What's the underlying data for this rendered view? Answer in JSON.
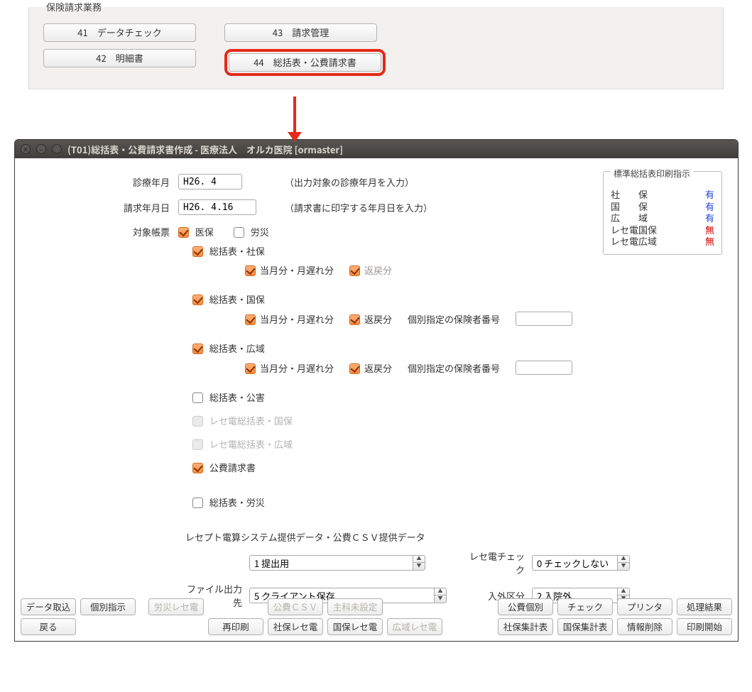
{
  "top_panel": {
    "legend": "保険請求業務",
    "btn41": "41　データチェック",
    "btn42": "42　明細書",
    "btn43": "43　請求管理",
    "btn44": "44　総括表・公費請求書"
  },
  "window": {
    "title": "(T01)総括表・公費請求書作成 - 医療法人　オルカ医院  [ormaster]"
  },
  "print_instructions": {
    "legend": "標準総括表印刷指示",
    "rows": [
      {
        "label": "社　　保",
        "value": "有",
        "cls": "blue"
      },
      {
        "label": "国　　保",
        "value": "有",
        "cls": "blue"
      },
      {
        "label": "広　　域",
        "value": "有",
        "cls": "blue"
      },
      {
        "label": "レセ電国保",
        "value": "無",
        "cls": "red"
      },
      {
        "label": "レセ電広域",
        "value": "無",
        "cls": "red"
      }
    ]
  },
  "form": {
    "medical_ym_label": "診療年月",
    "medical_ym_value": "H26. 4",
    "medical_ym_hint": "（出力対象の診療年月を入力）",
    "claim_date_label": "請求年月日",
    "claim_date_value": "H26. 4.16",
    "claim_date_hint": "（請求書に印字する年月日を入力）",
    "target_label": "対象帳票",
    "iho": "医保",
    "rosai": "労災",
    "shaho": "総括表・社保",
    "kokuho": "総括表・国保",
    "koiki": "総括表・広域",
    "kogai": "総括表・公害",
    "rece_kokuho": "レセ電総括表・国保",
    "rece_koiki": "レセ電総括表・広域",
    "kohi": "公費請求書",
    "sokatsu_rosai": "総括表・労災",
    "togetsu": "当月分・月遅れ分",
    "henrei": "返戻分",
    "kobetsu_label": "個別指定の保険者番号"
  },
  "csv": {
    "header": "レセプト電算システム提供データ・公費ＣＳＶ提供データ",
    "purpose": "1 提出用",
    "output_label": "ファイル出力先",
    "output": "5 クライアント保存",
    "check_label": "レセ電チェック",
    "check": "0 チェックしない",
    "nyugai_label": "入外区分",
    "nyugai": "2 入院外"
  },
  "buttons": {
    "row1": [
      "データ取込",
      "個別指示",
      "労災レセ電",
      "",
      "公費ＣＳＶ",
      "主科未設定",
      "公費個別",
      "チェック",
      "プリンタ",
      "処理結果"
    ],
    "row2": [
      "戻る",
      "",
      "再印刷",
      "社保レセ電",
      "国保レセ電",
      "広域レセ電",
      "社保集計表",
      "国保集計表",
      "情報削除",
      "印刷開始"
    ]
  }
}
